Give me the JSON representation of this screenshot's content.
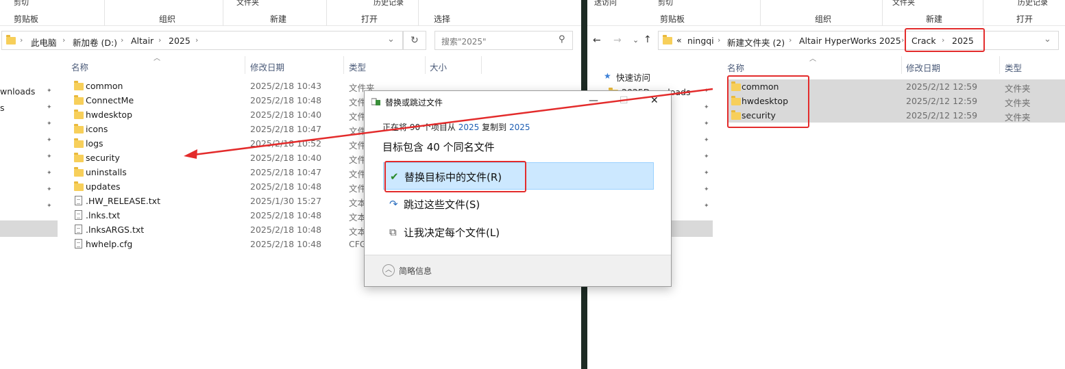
{
  "left": {
    "ribbon": {
      "top_items": [
        "剪切",
        "文件夹",
        "历史记录"
      ],
      "groups": [
        "剪贴板",
        "组织",
        "新建",
        "打开",
        "选择"
      ]
    },
    "address": [
      "此电脑",
      "新加卷 (D:)",
      "Altair",
      "2025"
    ],
    "search_placeholder": "搜索\"2025\"",
    "nav_items": [
      "wnloads",
      "s"
    ],
    "columns": {
      "name": "名称",
      "date": "修改日期",
      "type": "类型",
      "size": "大小"
    },
    "rows": [
      {
        "name": "common",
        "date": "2025/2/18 10:43",
        "type": "文件夹",
        "kind": "folder"
      },
      {
        "name": "ConnectMe",
        "date": "2025/2/18 10:48",
        "type": "文件",
        "kind": "folder"
      },
      {
        "name": "hwdesktop",
        "date": "2025/2/18 10:40",
        "type": "文件",
        "kind": "folder"
      },
      {
        "name": "icons",
        "date": "2025/2/18 10:47",
        "type": "文件",
        "kind": "folder"
      },
      {
        "name": "logs",
        "date": "2025/2/18 10:52",
        "type": "文件",
        "kind": "folder"
      },
      {
        "name": "security",
        "date": "2025/2/18 10:40",
        "type": "文件",
        "kind": "folder"
      },
      {
        "name": "uninstalls",
        "date": "2025/2/18 10:47",
        "type": "文件",
        "kind": "folder"
      },
      {
        "name": "updates",
        "date": "2025/2/18 10:48",
        "type": "文件",
        "kind": "folder"
      },
      {
        "name": ".HW_RELEASE.txt",
        "date": "2025/1/30 15:27",
        "type": "文本",
        "kind": "file"
      },
      {
        "name": ".lnks.txt",
        "date": "2025/2/18 10:48",
        "type": "文本",
        "kind": "file"
      },
      {
        "name": ".lnksARGS.txt",
        "date": "2025/2/18 10:48",
        "type": "文本",
        "kind": "file"
      },
      {
        "name": "hwhelp.cfg",
        "date": "2025/2/18 10:48",
        "type": "CFG",
        "kind": "file"
      }
    ]
  },
  "right": {
    "ribbon": {
      "top_items": [
        "送访问",
        "剪切",
        "文件夹",
        "历史记录"
      ],
      "groups": [
        "剪贴板",
        "组织",
        "新建",
        "打开"
      ]
    },
    "address": [
      "ningqi",
      "新建文件夹 (2)",
      "Altair HyperWorks 2025",
      "Crack",
      "2025"
    ],
    "address_prefix": "«",
    "quick_access": "快速访问",
    "nav_partial": "2025Downloads",
    "columns": {
      "name": "名称",
      "date": "修改日期",
      "type": "类型"
    },
    "rows": [
      {
        "name": "common",
        "date": "2025/2/12 12:59",
        "type": "文件夹"
      },
      {
        "name": "hwdesktop",
        "date": "2025/2/12 12:59",
        "type": "文件夹"
      },
      {
        "name": "security",
        "date": "2025/2/12 12:59",
        "type": "文件夹"
      }
    ]
  },
  "dialog": {
    "title": "替换或跳过文件",
    "line1_pre": "正在将 90 个项目从",
    "line1_src": "2025",
    "line1_mid": "复制到",
    "line1_dst": "2025",
    "line2": "目标包含 40 个同名文件",
    "options": [
      "替换目标中的文件(R)",
      "跳过这些文件(S)",
      "让我决定每个文件(L)"
    ],
    "footer": "简略信息",
    "controls": [
      "—",
      "☐",
      "✕"
    ]
  },
  "colors": {
    "annotation": "#e32b2b",
    "selection": "#cce8ff",
    "link": "#1f5fb4"
  }
}
